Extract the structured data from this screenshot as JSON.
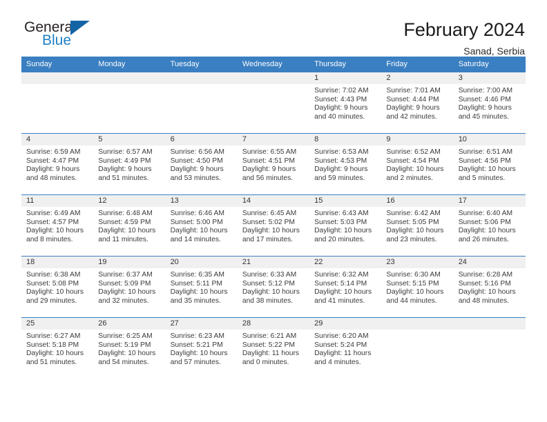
{
  "brand": {
    "name_part1": "General",
    "name_part2": "Blue",
    "triangle_color": "#1464a5",
    "blue_text_color": "#1f7fc4"
  },
  "header": {
    "title": "February 2024",
    "location": "Sanad, Serbia"
  },
  "theme": {
    "header_bar_color": "#3a7fc1",
    "day_band_color": "#f0f0f0",
    "row_divider_color": "#3a7fc1"
  },
  "weekdays": [
    "Sunday",
    "Monday",
    "Tuesday",
    "Wednesday",
    "Thursday",
    "Friday",
    "Saturday"
  ],
  "weeks": [
    [
      {
        "day": "",
        "empty": true
      },
      {
        "day": "",
        "empty": true
      },
      {
        "day": "",
        "empty": true
      },
      {
        "day": "",
        "empty": true
      },
      {
        "day": "1",
        "sunrise": "Sunrise: 7:02 AM",
        "sunset": "Sunset: 4:43 PM",
        "daylight1": "Daylight: 9 hours",
        "daylight2": "and 40 minutes."
      },
      {
        "day": "2",
        "sunrise": "Sunrise: 7:01 AM",
        "sunset": "Sunset: 4:44 PM",
        "daylight1": "Daylight: 9 hours",
        "daylight2": "and 42 minutes."
      },
      {
        "day": "3",
        "sunrise": "Sunrise: 7:00 AM",
        "sunset": "Sunset: 4:46 PM",
        "daylight1": "Daylight: 9 hours",
        "daylight2": "and 45 minutes."
      }
    ],
    [
      {
        "day": "4",
        "sunrise": "Sunrise: 6:59 AM",
        "sunset": "Sunset: 4:47 PM",
        "daylight1": "Daylight: 9 hours",
        "daylight2": "and 48 minutes."
      },
      {
        "day": "5",
        "sunrise": "Sunrise: 6:57 AM",
        "sunset": "Sunset: 4:49 PM",
        "daylight1": "Daylight: 9 hours",
        "daylight2": "and 51 minutes."
      },
      {
        "day": "6",
        "sunrise": "Sunrise: 6:56 AM",
        "sunset": "Sunset: 4:50 PM",
        "daylight1": "Daylight: 9 hours",
        "daylight2": "and 53 minutes."
      },
      {
        "day": "7",
        "sunrise": "Sunrise: 6:55 AM",
        "sunset": "Sunset: 4:51 PM",
        "daylight1": "Daylight: 9 hours",
        "daylight2": "and 56 minutes."
      },
      {
        "day": "8",
        "sunrise": "Sunrise: 6:53 AM",
        "sunset": "Sunset: 4:53 PM",
        "daylight1": "Daylight: 9 hours",
        "daylight2": "and 59 minutes."
      },
      {
        "day": "9",
        "sunrise": "Sunrise: 6:52 AM",
        "sunset": "Sunset: 4:54 PM",
        "daylight1": "Daylight: 10 hours",
        "daylight2": "and 2 minutes."
      },
      {
        "day": "10",
        "sunrise": "Sunrise: 6:51 AM",
        "sunset": "Sunset: 4:56 PM",
        "daylight1": "Daylight: 10 hours",
        "daylight2": "and 5 minutes."
      }
    ],
    [
      {
        "day": "11",
        "sunrise": "Sunrise: 6:49 AM",
        "sunset": "Sunset: 4:57 PM",
        "daylight1": "Daylight: 10 hours",
        "daylight2": "and 8 minutes."
      },
      {
        "day": "12",
        "sunrise": "Sunrise: 6:48 AM",
        "sunset": "Sunset: 4:59 PM",
        "daylight1": "Daylight: 10 hours",
        "daylight2": "and 11 minutes."
      },
      {
        "day": "13",
        "sunrise": "Sunrise: 6:46 AM",
        "sunset": "Sunset: 5:00 PM",
        "daylight1": "Daylight: 10 hours",
        "daylight2": "and 14 minutes."
      },
      {
        "day": "14",
        "sunrise": "Sunrise: 6:45 AM",
        "sunset": "Sunset: 5:02 PM",
        "daylight1": "Daylight: 10 hours",
        "daylight2": "and 17 minutes."
      },
      {
        "day": "15",
        "sunrise": "Sunrise: 6:43 AM",
        "sunset": "Sunset: 5:03 PM",
        "daylight1": "Daylight: 10 hours",
        "daylight2": "and 20 minutes."
      },
      {
        "day": "16",
        "sunrise": "Sunrise: 6:42 AM",
        "sunset": "Sunset: 5:05 PM",
        "daylight1": "Daylight: 10 hours",
        "daylight2": "and 23 minutes."
      },
      {
        "day": "17",
        "sunrise": "Sunrise: 6:40 AM",
        "sunset": "Sunset: 5:06 PM",
        "daylight1": "Daylight: 10 hours",
        "daylight2": "and 26 minutes."
      }
    ],
    [
      {
        "day": "18",
        "sunrise": "Sunrise: 6:38 AM",
        "sunset": "Sunset: 5:08 PM",
        "daylight1": "Daylight: 10 hours",
        "daylight2": "and 29 minutes."
      },
      {
        "day": "19",
        "sunrise": "Sunrise: 6:37 AM",
        "sunset": "Sunset: 5:09 PM",
        "daylight1": "Daylight: 10 hours",
        "daylight2": "and 32 minutes."
      },
      {
        "day": "20",
        "sunrise": "Sunrise: 6:35 AM",
        "sunset": "Sunset: 5:11 PM",
        "daylight1": "Daylight: 10 hours",
        "daylight2": "and 35 minutes."
      },
      {
        "day": "21",
        "sunrise": "Sunrise: 6:33 AM",
        "sunset": "Sunset: 5:12 PM",
        "daylight1": "Daylight: 10 hours",
        "daylight2": "and 38 minutes."
      },
      {
        "day": "22",
        "sunrise": "Sunrise: 6:32 AM",
        "sunset": "Sunset: 5:14 PM",
        "daylight1": "Daylight: 10 hours",
        "daylight2": "and 41 minutes."
      },
      {
        "day": "23",
        "sunrise": "Sunrise: 6:30 AM",
        "sunset": "Sunset: 5:15 PM",
        "daylight1": "Daylight: 10 hours",
        "daylight2": "and 44 minutes."
      },
      {
        "day": "24",
        "sunrise": "Sunrise: 6:28 AM",
        "sunset": "Sunset: 5:16 PM",
        "daylight1": "Daylight: 10 hours",
        "daylight2": "and 48 minutes."
      }
    ],
    [
      {
        "day": "25",
        "sunrise": "Sunrise: 6:27 AM",
        "sunset": "Sunset: 5:18 PM",
        "daylight1": "Daylight: 10 hours",
        "daylight2": "and 51 minutes."
      },
      {
        "day": "26",
        "sunrise": "Sunrise: 6:25 AM",
        "sunset": "Sunset: 5:19 PM",
        "daylight1": "Daylight: 10 hours",
        "daylight2": "and 54 minutes."
      },
      {
        "day": "27",
        "sunrise": "Sunrise: 6:23 AM",
        "sunset": "Sunset: 5:21 PM",
        "daylight1": "Daylight: 10 hours",
        "daylight2": "and 57 minutes."
      },
      {
        "day": "28",
        "sunrise": "Sunrise: 6:21 AM",
        "sunset": "Sunset: 5:22 PM",
        "daylight1": "Daylight: 11 hours",
        "daylight2": "and 0 minutes."
      },
      {
        "day": "29",
        "sunrise": "Sunrise: 6:20 AM",
        "sunset": "Sunset: 5:24 PM",
        "daylight1": "Daylight: 11 hours",
        "daylight2": "and 4 minutes."
      },
      {
        "day": "",
        "empty": true
      },
      {
        "day": "",
        "empty": true
      }
    ]
  ]
}
